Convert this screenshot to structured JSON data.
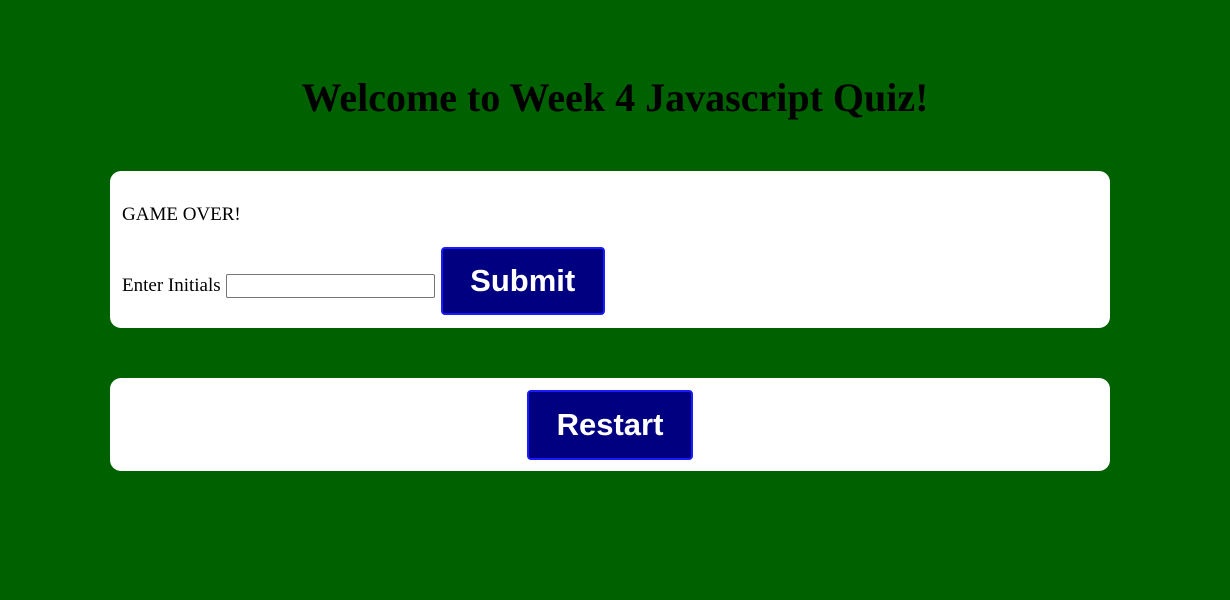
{
  "header": {
    "title": "Welcome to Week 4 Javascript Quiz!"
  },
  "result": {
    "status_text": "GAME OVER!",
    "initials_label": "Enter Initials",
    "initials_value": "",
    "submit_label": "Submit"
  },
  "controls": {
    "restart_label": "Restart"
  },
  "colors": {
    "background": "#006100",
    "card": "#ffffff",
    "button_bg": "#000080",
    "button_border": "#1a1aff",
    "button_text": "#ffffff"
  }
}
